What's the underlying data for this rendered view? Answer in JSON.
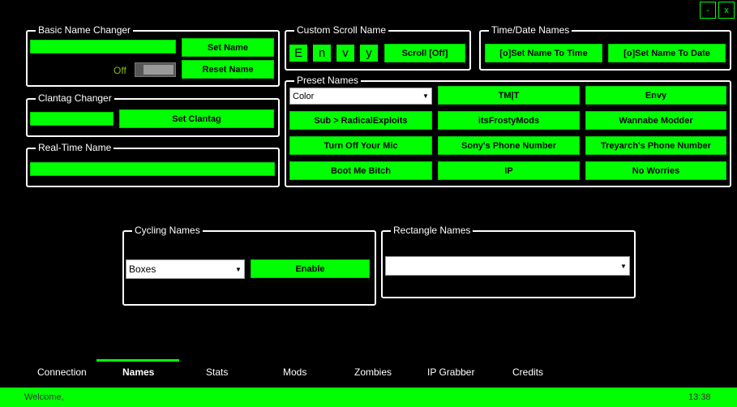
{
  "colors": {
    "accent": "#00ff00",
    "background": "#000000",
    "border": "#ffffff"
  },
  "window_controls": {
    "minimize": "-",
    "close": "x"
  },
  "basic_name_changer": {
    "title": "Basic Name Changer",
    "set_name": "Set Name",
    "reset_name": "Reset Name",
    "toggle_label": "Off",
    "toggle_state": "off"
  },
  "clantag_changer": {
    "title": "Clantag Changer",
    "set_clantag": "Set Clantag"
  },
  "realtime_name": {
    "title": "Real-Time Name"
  },
  "custom_scroll_name": {
    "title": "Custom Scroll Name",
    "letters": [
      "E",
      "n",
      "v",
      "y"
    ],
    "scroll_button": "Scroll [Off]"
  },
  "time_date_names": {
    "title": "Time/Date Names",
    "set_to_time": "[o]Set Name To Time",
    "set_to_date": "[o]Set Name To Date"
  },
  "preset_names": {
    "title": "Preset Names",
    "color_select": "Color",
    "buttons": [
      "TM|T",
      "Envy",
      "Sub > RadicalExploits",
      "itsFrostyMods",
      "Wannabe Modder",
      "Turn Off Your Mic",
      "Sony's Phone Number",
      "Treyarch's Phone Number",
      "Boot Me Bitch",
      "IP",
      "No Worries"
    ]
  },
  "cycling_names": {
    "title": "Cycling Names",
    "select_value": "Boxes",
    "enable": "Enable"
  },
  "rectangle_names": {
    "title": "Rectangle Names",
    "select_value": ""
  },
  "tabs": [
    "Connection",
    "Names",
    "Stats",
    "Mods",
    "Zombies",
    "IP Grabber",
    "Credits"
  ],
  "active_tab": "Names",
  "status_bar": {
    "message": "Welcome,",
    "time": "13:38"
  }
}
